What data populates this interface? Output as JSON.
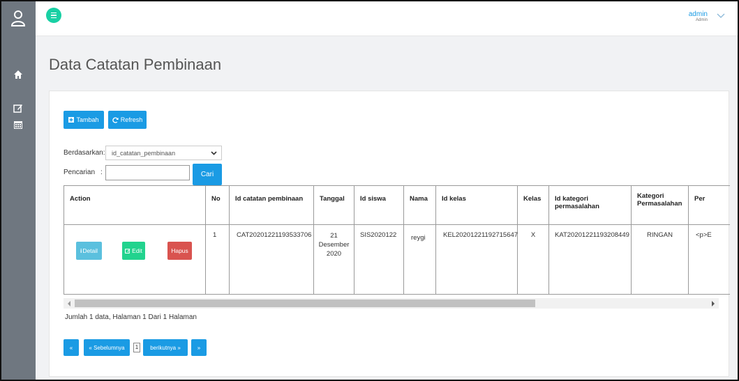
{
  "topbar": {
    "user_name": "admin",
    "user_role": "Admin"
  },
  "page": {
    "title": "Data Catatan Pembinaan"
  },
  "toolbar": {
    "add_label": "Tambah",
    "refresh_label": "Refresh"
  },
  "filter": {
    "based_on_label": "Berdasarkan:",
    "selected_field": "id_catatan_pembinaan",
    "search_label": "Pencarian",
    "search_sep": ":",
    "search_value": "",
    "search_button": "Cari"
  },
  "table": {
    "headers": [
      "Action",
      "No",
      "Id catatan pembinaan",
      "Tanggal",
      "Id siswa",
      "Nama",
      "Id kelas",
      "Kelas",
      "Id kategori permasalahan",
      "Kategori Permasalahan",
      "Per"
    ],
    "row": {
      "detail_label": "Detail",
      "edit_label": "Edit",
      "delete_label": "Hapus",
      "no": "1",
      "id_catatan": "CAT20201221193533706",
      "tanggal_day": "21",
      "tanggal_month": "Desember",
      "tanggal_year": "2020",
      "id_siswa": "SIS2020122",
      "nama": "reygi",
      "id_kelas": "KEL20201221192715647",
      "kelas": "X",
      "id_kategori": "KAT20201221193208449",
      "kategori": "RINGAN",
      "per": "<p>E"
    }
  },
  "footer": {
    "summary": "Jumlah 1 data, Halaman 1 Dari 1 Halaman",
    "first_label": "«",
    "prev_label": "« Sebelumnya",
    "current_page": "1",
    "next_label": "berikutnya »",
    "last_label": "»"
  },
  "colors": {
    "sidebar": "#6f7780",
    "accent_blue": "#1a9be4",
    "accent_green": "#22d38e",
    "danger": "#d9534f",
    "info": "#5bc0de"
  },
  "icons": [
    "user-icon",
    "home-icon",
    "edit-icon",
    "calendar-icon",
    "menu-icon",
    "chevron-down-icon",
    "plus-square-icon",
    "refresh-icon",
    "info-icon"
  ]
}
